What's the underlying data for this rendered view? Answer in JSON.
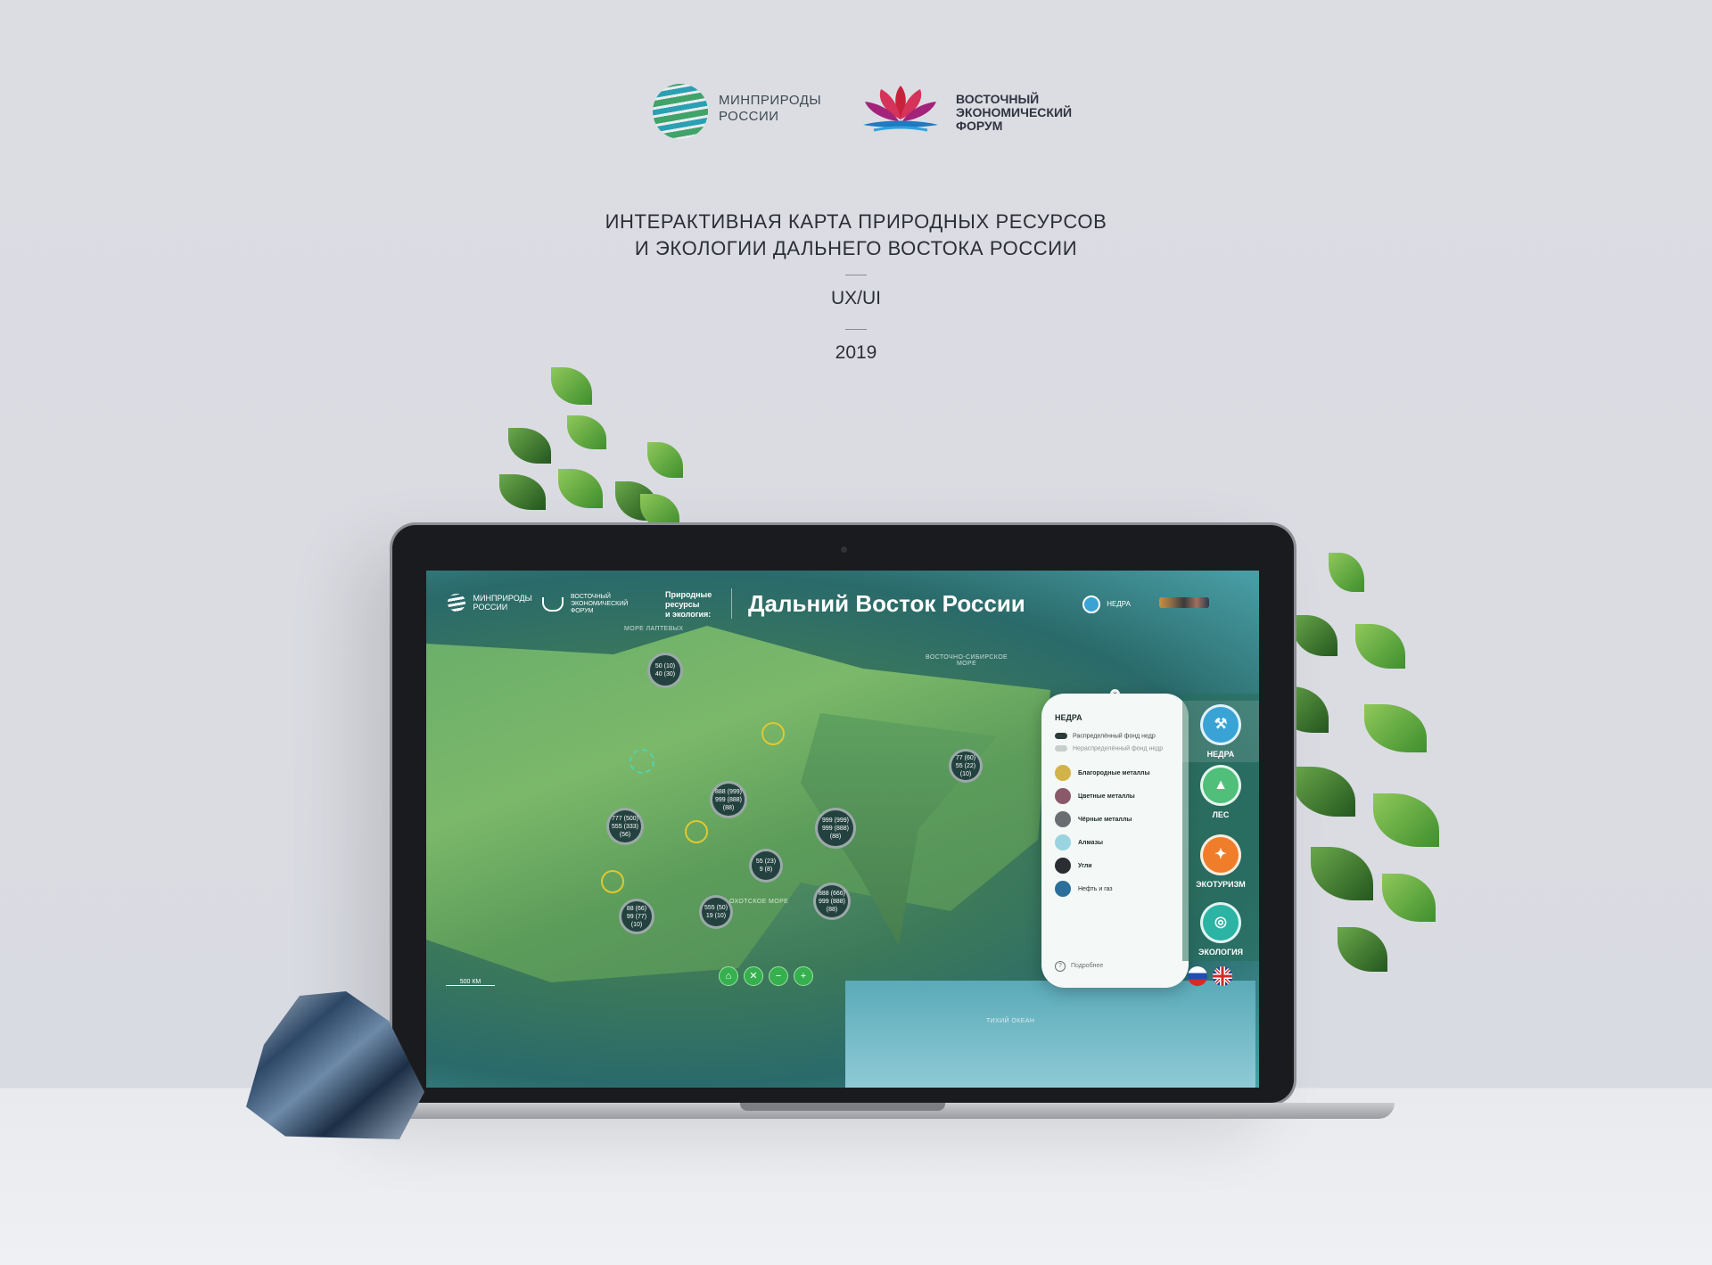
{
  "header": {
    "logo_minprirody": [
      "МИНПРИРОДЫ",
      "РОССИИ"
    ],
    "logo_eef": [
      "ВОСТОЧНЫЙ",
      "ЭКОНОМИЧЕСКИЙ",
      "ФОРУМ"
    ],
    "title_line1": "ИНТЕРАКТИВНАЯ КАРТА ПРИРОДНЫХ РЕСУРСОВ",
    "title_line2": "И ЭКОЛОГИИ ДАЛЬНЕГО ВОСТОКА РОССИИ",
    "uxui": "UX/UI",
    "year": "2019"
  },
  "screen": {
    "logo_minprirody": [
      "МИНПРИРОДЫ",
      "РОССИИ"
    ],
    "logo_eef": [
      "ВОСТОЧНЫЙ",
      "ЭКОНОМИЧЕСКИЙ",
      "ФОРУМ"
    ],
    "subtitle": [
      "Природные",
      "ресурсы",
      "и экология:"
    ],
    "heading": "Дальний Восток России",
    "top_chip": "НЕДРА",
    "sea_labels": {
      "laptev": "МОРЕ ЛАПТЕВЫХ",
      "east_siberian": [
        "ВОСТОЧНО-СИБИРСКОЕ",
        "МОРЕ"
      ],
      "okhotsk": "ОХОТСКОЕ МОРЕ",
      "pacific": "ТИХИЙ ОКЕАН"
    },
    "scale": "500 КМ",
    "bubbles": [
      {
        "top": "50 (10)",
        "bottom": "40 (30)"
      },
      {
        "top": "77 (60)",
        "bottom": "55 (22)",
        "extra": "(10)"
      },
      {
        "top": "888 (999)",
        "bottom": "999 (888)",
        "extra": "(88)"
      },
      {
        "top": "777 (500)",
        "bottom": "555 (333)",
        "extra": "(56)"
      },
      {
        "top": "999 (999)",
        "bottom": "999 (888)",
        "extra": "(88)"
      },
      {
        "top": "55 (23)",
        "bottom": "9 (8)"
      },
      {
        "top": "888 (666)",
        "bottom": "999 (888)",
        "extra": "(88)"
      },
      {
        "top": "88 (66)",
        "bottom": "99 (77)",
        "extra": "(10)"
      },
      {
        "top": "555 (50)",
        "bottom": "19 (10)"
      }
    ],
    "panel": {
      "title": "НЕДРА",
      "toggle_on": "Распределённый фонд недр",
      "toggle_off": "Нераспределённый фонд недр",
      "items": [
        "Благородные металлы",
        "Цветные металлы",
        "Чёрные металлы",
        "Алмазы",
        "Угли",
        "Нефть и газ"
      ],
      "help": "Подробнее"
    },
    "rail": [
      "НЕДРА",
      "ЛЕС",
      "ЭКОТУРИЗМ",
      "ЭКОЛОГИЯ"
    ],
    "controls": [
      "⌂",
      "✕",
      "−",
      "+"
    ],
    "colors": {
      "accent_green": "#36b04e",
      "nedra": "#3aa3d6",
      "les": "#4fbf7a",
      "ecotourism": "#f07d2a",
      "ecology": "#2bb3a4"
    }
  }
}
